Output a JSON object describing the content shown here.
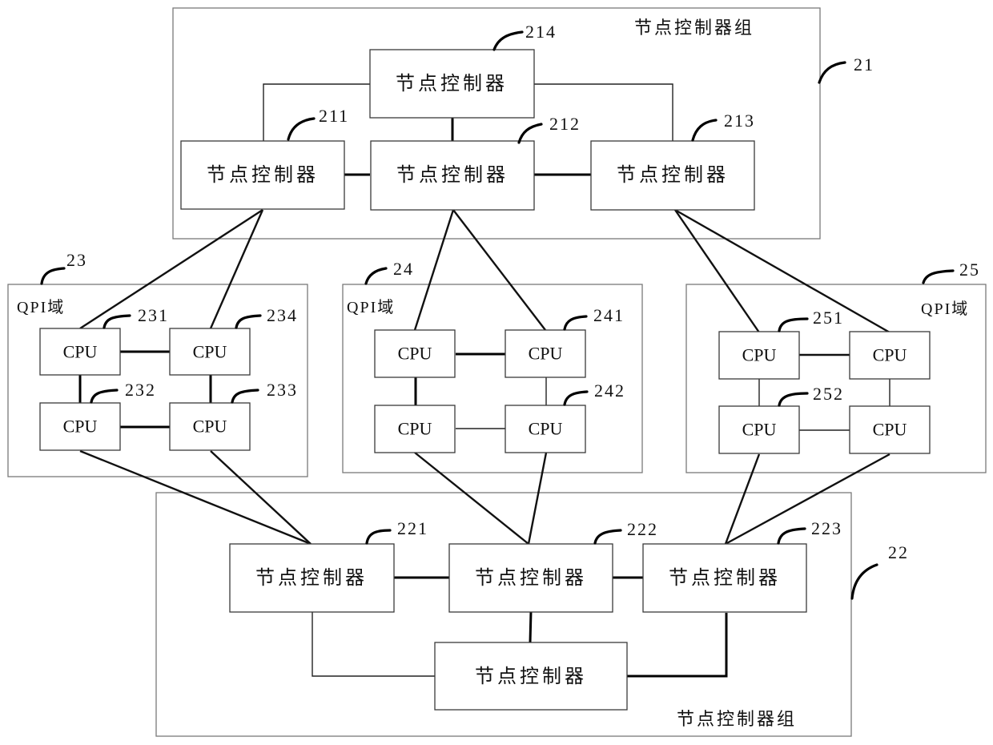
{
  "diagram": {
    "groups": {
      "group_21": {
        "ref": "21",
        "title": "节点控制器组"
      },
      "group_22": {
        "ref": "22",
        "title": "节点控制器组"
      }
    },
    "controllers": {
      "c211": {
        "ref": "211",
        "label": "节点控制器"
      },
      "c212": {
        "ref": "212",
        "label": "节点控制器"
      },
      "c213": {
        "ref": "213",
        "label": "节点控制器"
      },
      "c214": {
        "ref": "214",
        "label": "节点控制器"
      },
      "c221": {
        "ref": "221",
        "label": "节点控制器"
      },
      "c222": {
        "ref": "222",
        "label": "节点控制器"
      },
      "c223": {
        "ref": "223",
        "label": "节点控制器"
      },
      "c224": {
        "label": "节点控制器"
      }
    },
    "domains": {
      "d23": {
        "ref": "23",
        "label": "QPI域"
      },
      "d24": {
        "ref": "24",
        "label": "QPI域"
      },
      "d25": {
        "ref": "25",
        "label": "QPI域"
      }
    },
    "cpu_label": "CPU",
    "cpu_refs": {
      "r231": "231",
      "r232": "232",
      "r233": "233",
      "r234": "234",
      "r241": "241",
      "r242": "242",
      "r251": "251",
      "r252": "252"
    }
  }
}
